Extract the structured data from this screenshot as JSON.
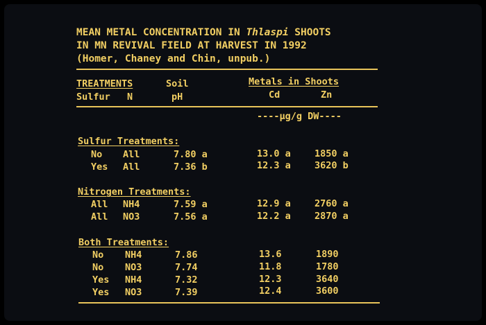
{
  "title": {
    "line1_pre": "MEAN METAL CONCENTRATION IN ",
    "line1_italic": "Thlaspi",
    "line1_post": " SHOOTS",
    "line2": "IN MN REVIVAL FIELD AT HARVEST IN 1992",
    "line3": "(Homer, Chaney and Chin, unpub.)"
  },
  "header": {
    "treatments": "TREATMENTS",
    "sulfur": "Sulfur",
    "n": "N",
    "soil": "Soil",
    "ph": "pH",
    "metals": "Metals in Shoots",
    "cd": "Cd",
    "zn": "Zn",
    "units": "----µg/g DW----"
  },
  "sections": [
    {
      "heading": "Sulfur Treatments:",
      "rows": [
        {
          "sulfur": "No",
          "n": "All",
          "ph": "7.80 a",
          "cd": "13.0 a",
          "zn": "1850 a"
        },
        {
          "sulfur": "Yes",
          "n": "All",
          "ph": "7.36 b",
          "cd": "12.3 a",
          "zn": "3620 b"
        }
      ]
    },
    {
      "heading": "Nitrogen Treatments:",
      "rows": [
        {
          "sulfur": "All",
          "n": "NH4",
          "ph": "7.59 a",
          "cd": "12.9 a",
          "zn": "2760 a"
        },
        {
          "sulfur": "All",
          "n": "NO3",
          "ph": "7.56 a",
          "cd": "12.2 a",
          "zn": "2870 a"
        }
      ]
    },
    {
      "heading": "Both Treatments:",
      "rows": [
        {
          "sulfur": "No",
          "n": "NH4",
          "ph": "7.86",
          "cd": "13.6",
          "zn": "1890"
        },
        {
          "sulfur": "No",
          "n": "NO3",
          "ph": "7.74",
          "cd": "11.8",
          "zn": "1780"
        },
        {
          "sulfur": "Yes",
          "n": "NH4",
          "ph": "7.32",
          "cd": "12.3",
          "zn": "3640"
        },
        {
          "sulfur": "Yes",
          "n": "NO3",
          "ph": "7.39",
          "cd": "12.4",
          "zn": "3600"
        }
      ]
    }
  ]
}
